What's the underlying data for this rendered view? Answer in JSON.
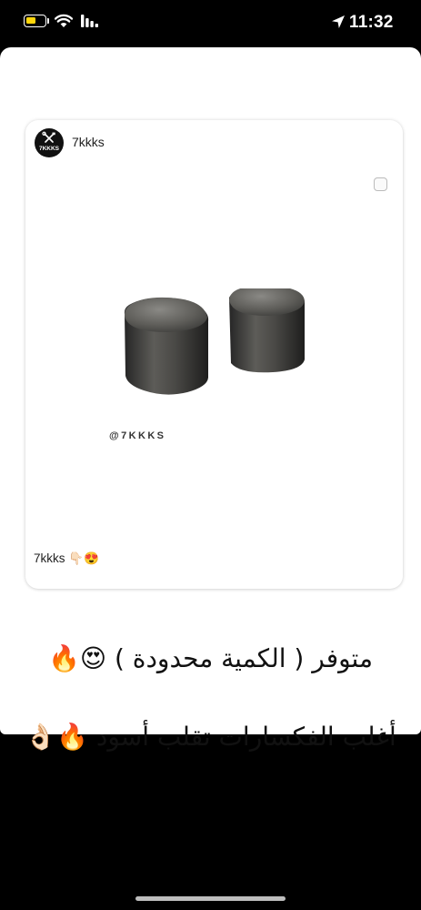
{
  "status_bar": {
    "time": "11:32",
    "battery_level": 0.55,
    "battery_color": "#ffd60a",
    "icons": [
      "battery-icon",
      "wifi-icon",
      "cellular-signal-icon",
      "location-arrow-icon"
    ]
  },
  "post": {
    "avatar_text": "7KKKS",
    "username": "7kkks",
    "watermark": "@7KKKS",
    "caption": "7kkks 👇🏻😍",
    "image_subject": "two dark metallic cylindrical caps"
  },
  "story_text": {
    "line1": "متوفر ( الكمية محدودة ) 😍🔥",
    "line2": "أغلب الفكسارات تقلب أسود 🔥👌🏻"
  }
}
